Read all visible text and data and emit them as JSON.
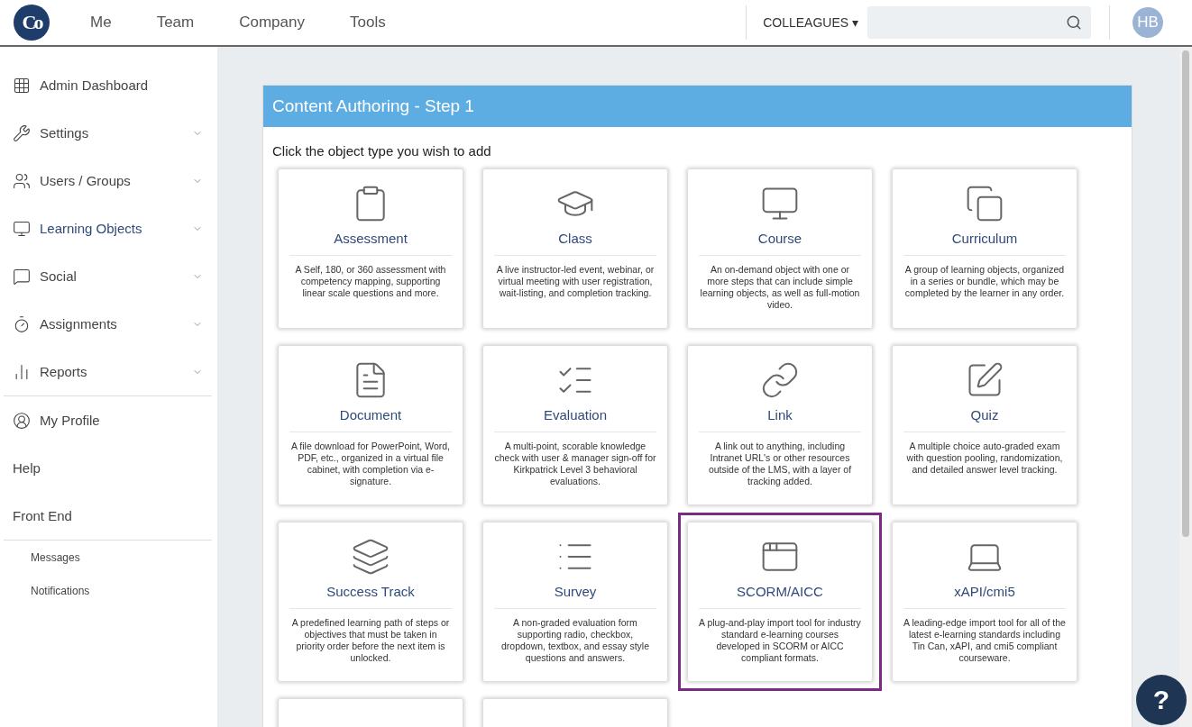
{
  "logo": {
    "text": "Co"
  },
  "nav": [
    {
      "label": "Me"
    },
    {
      "label": "Team"
    },
    {
      "label": "Company"
    },
    {
      "label": "Tools"
    }
  ],
  "colleagues": {
    "label": "COLLEAGUES",
    "caret": "▾"
  },
  "avatar": {
    "initials": "HB"
  },
  "sidebar": {
    "groups": [
      [
        {
          "label": "Admin Dashboard",
          "kind": "icon",
          "expandable": false,
          "selected": false
        },
        {
          "label": "Settings",
          "kind": "icon",
          "expandable": true,
          "selected": false
        },
        {
          "label": "Users / Groups",
          "kind": "icon",
          "expandable": true,
          "selected": false
        },
        {
          "label": "Learning Objects",
          "kind": "icon",
          "expandable": true,
          "selected": true
        },
        {
          "label": "Social",
          "kind": "icon",
          "expandable": true,
          "selected": false
        },
        {
          "label": "Assignments",
          "kind": "icon",
          "expandable": true,
          "selected": false
        },
        {
          "label": "Reports",
          "kind": "icon",
          "expandable": true,
          "selected": false
        }
      ],
      [
        {
          "label": "My Profile",
          "kind": "icon",
          "expandable": false,
          "selected": false
        },
        {
          "label": "Help",
          "kind": "plain",
          "expandable": false,
          "selected": false
        },
        {
          "label": "Front End",
          "kind": "plain",
          "expandable": false,
          "selected": false
        }
      ],
      [
        {
          "label": "Messages",
          "kind": "small",
          "expandable": false,
          "selected": false
        },
        {
          "label": "Notifications",
          "kind": "small",
          "expandable": false,
          "selected": false
        }
      ]
    ]
  },
  "panel": {
    "title": "Content Authoring - Step 1",
    "instruction": "Click the object type you wish to add",
    "cards": [
      {
        "kind": "object",
        "title": "Assessment",
        "description": "A Self, 180, or 360 assessment with competency mapping, supporting linear scale questions and more.",
        "selected": false
      },
      {
        "kind": "object",
        "title": "Class",
        "description": "A live instructor-led event, webinar, or virtual meeting with user registration, wait-listing, and completion tracking.",
        "selected": false
      },
      {
        "kind": "object",
        "title": "Course",
        "description": "An on-demand object with one or more steps that can include simple learning objects, as well as full-motion video.",
        "selected": false
      },
      {
        "kind": "object",
        "title": "Curriculum",
        "description": "A group of learning objects, organized in a series or bundle, which may be completed by the learner in any order.",
        "selected": false
      },
      {
        "kind": "object",
        "title": "Document",
        "description": "A file download for PowerPoint, Word, PDF, etc., organized in a virtual file cabinet, with completion via e-signature.",
        "selected": false
      },
      {
        "kind": "object",
        "title": "Evaluation",
        "description": "A multi-point, scorable knowledge check with user & manager sign-off for Kirkpatrick Level 3 behavioral evaluations.",
        "selected": false
      },
      {
        "kind": "object",
        "title": "Link",
        "description": "A link out to anything, including Intranet URL's or other resources outside of the LMS, with a layer of tracking added.",
        "selected": false
      },
      {
        "kind": "object",
        "title": "Quiz",
        "description": "A multiple choice auto-graded exam with question pooling, randomization, and detailed answer level tracking.",
        "selected": false
      },
      {
        "kind": "object",
        "title": "Success Track",
        "description": "A predefined learning path of steps or objectives that must be taken in priority order before the next item is unlocked.",
        "selected": false
      },
      {
        "kind": "object",
        "title": "Survey",
        "description": "A non-graded evaluation form supporting radio, checkbox, dropdown, textbox, and essay style questions and answers.",
        "selected": false
      },
      {
        "kind": "object",
        "title": "SCORM/AICC",
        "description": "A plug-and-play import tool for industry standard e-learning courses developed in SCORM or AICC compliant formats.",
        "selected": true
      },
      {
        "kind": "object",
        "title": "xAPI/cmi5",
        "description": "A leading-edge import tool for all of the latest e-learning standards including Tin Can, xAPI, and cmi5 compliant courseware.",
        "selected": false
      },
      {
        "kind": "cutoff",
        "selected": false
      },
      {
        "kind": "cutoff",
        "selected": false
      }
    ]
  },
  "help_button": {
    "label": "?"
  }
}
